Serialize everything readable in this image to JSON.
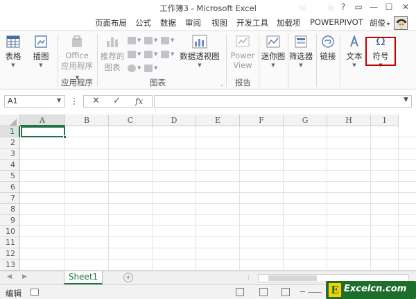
{
  "window": {
    "title": "工作簿3 - Microsoft Excel",
    "controls": {
      "help": "?",
      "restore": "▭",
      "minimize": "—",
      "maximize": "☐",
      "close": "✕"
    }
  },
  "tabs": [
    "页面布局",
    "公式",
    "数据",
    "审阅",
    "视图",
    "开发工具",
    "加载项",
    "POWERPIVOT"
  ],
  "user": {
    "name": "胡俊",
    "caret": "▾"
  },
  "ribbon": {
    "buttons": {
      "table": "表格",
      "illustrations": "插图",
      "office_apps_line1": "Office",
      "office_apps_line2": "应用程序",
      "recommended_charts_line1": "推荐的",
      "recommended_charts_line2": "图表",
      "pivot_chart": "数据透视图",
      "power_view_line1": "Power",
      "power_view_line2": "View",
      "sparklines": "迷你图",
      "slicer": "筛选器",
      "links": "链接",
      "text": "文本",
      "symbols": "符号",
      "symbols_icon": "Ω"
    },
    "groups": {
      "apps": "应用程序",
      "charts": "图表",
      "reports": "报告"
    },
    "accent": "#c00000"
  },
  "formula_bar": {
    "name_box": "A1",
    "cancel": "✕",
    "enter": "✓",
    "fx": "fx",
    "formula": ""
  },
  "grid": {
    "columns": [
      "A",
      "B",
      "C",
      "D",
      "E",
      "F",
      "G",
      "H",
      "I"
    ],
    "rows": [
      "1",
      "2",
      "3",
      "4",
      "5",
      "6",
      "7",
      "8",
      "9",
      "10",
      "11",
      "12",
      "13"
    ],
    "active_cell": "A1",
    "accent": "#217346"
  },
  "sheets": {
    "tabs": [
      "Sheet1"
    ],
    "add": "+",
    "prev": "◀",
    "next": "▶"
  },
  "status": {
    "mode": "编辑",
    "zoom_minus": "−"
  },
  "watermark": {
    "letter": "E",
    "text": "Excelcn.com"
  }
}
